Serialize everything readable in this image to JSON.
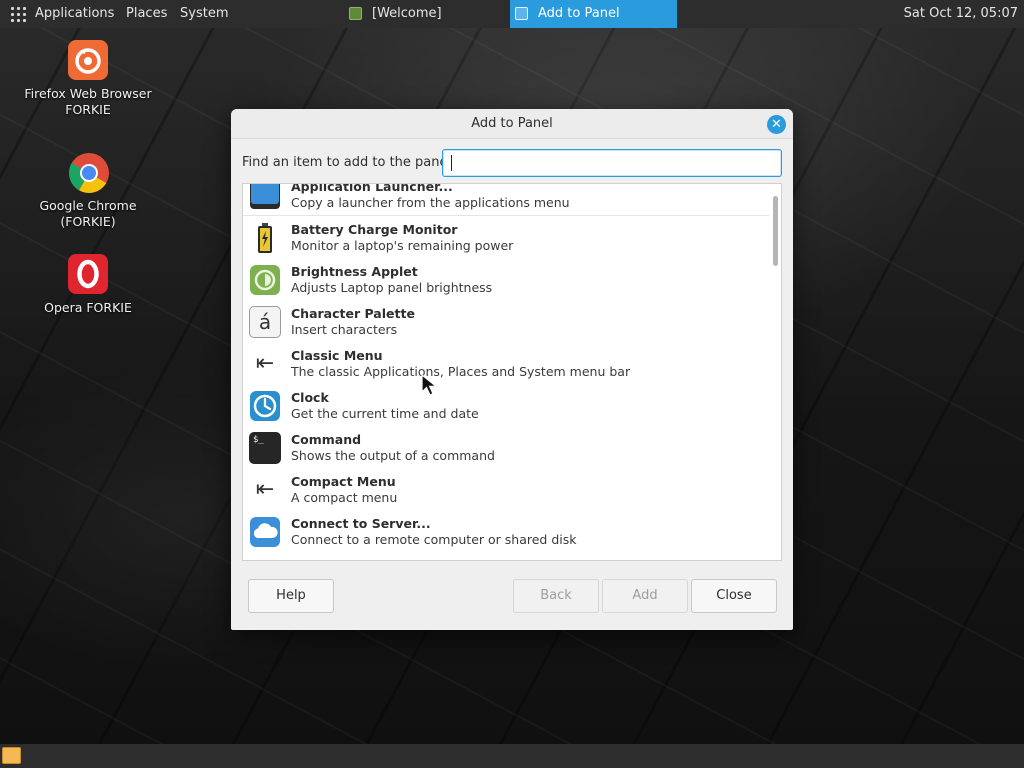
{
  "top_panel": {
    "menus": [
      "Applications",
      "Places",
      "System"
    ],
    "tasks": [
      {
        "label": "[Welcome]",
        "active": false
      },
      {
        "label": "Add to Panel",
        "active": true
      }
    ],
    "clock": "Sat Oct 12, 05:07"
  },
  "desktop_icons": [
    {
      "label_line1": "Firefox Web Browser",
      "label_line2": "FORKIE",
      "icon": "firefox-icon"
    },
    {
      "label_line1": "Google Chrome",
      "label_line2": "(FORKIE)",
      "icon": "chrome-icon"
    },
    {
      "label_line1": "Opera FORKIE",
      "label_line2": "",
      "icon": "opera-icon"
    }
  ],
  "dialog": {
    "title": "Add to Panel",
    "find_label": "Find an item to add to the panel:",
    "find_value": "",
    "items": [
      {
        "title": "Application Launcher...",
        "desc": "Copy a launcher from the applications menu",
        "icon": "launcher-icon"
      },
      {
        "title": "Battery Charge Monitor",
        "desc": "Monitor a laptop's remaining power",
        "icon": "battery-icon"
      },
      {
        "title": "Brightness Applet",
        "desc": "Adjusts Laptop panel brightness",
        "icon": "brightness-icon"
      },
      {
        "title": "Character Palette",
        "desc": "Insert characters",
        "icon": "character-palette-icon",
        "glyph": "á"
      },
      {
        "title": "Classic Menu",
        "desc": "The classic Applications, Places and System menu bar",
        "icon": "menu-arrow-icon",
        "glyph": "⇤"
      },
      {
        "title": "Clock",
        "desc": "Get the current time and date",
        "icon": "clock-icon"
      },
      {
        "title": "Command",
        "desc": "Shows the output of a command",
        "icon": "terminal-icon",
        "glyph": "$_"
      },
      {
        "title": "Compact Menu",
        "desc": "A compact menu",
        "icon": "menu-arrow-icon",
        "glyph": "⇤"
      },
      {
        "title": "Connect to Server...",
        "desc": "Connect to a remote computer or shared disk",
        "icon": "cloud-icon"
      }
    ],
    "buttons": {
      "help": "Help",
      "back": "Back",
      "add": "Add",
      "close": "Close"
    },
    "close_glyph": "✕"
  },
  "colors": {
    "accent": "#2a9bdc",
    "panel": "#2d2d2d"
  }
}
